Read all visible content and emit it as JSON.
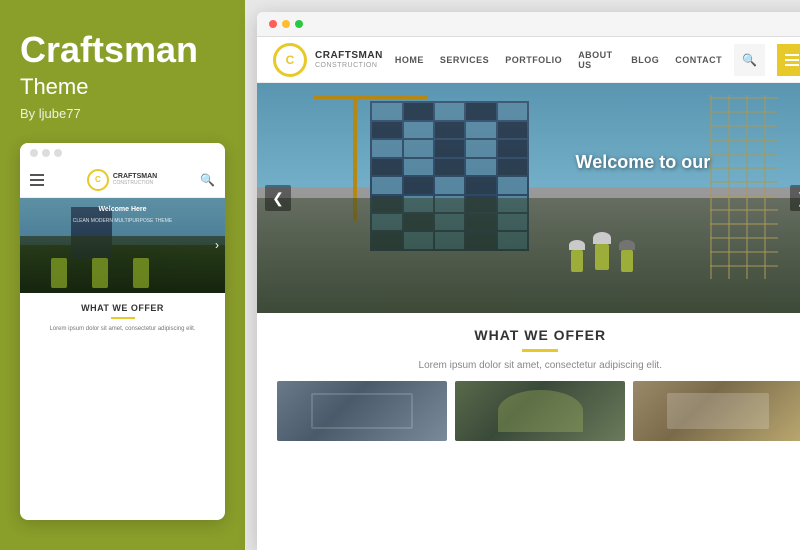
{
  "left": {
    "title": "Craftsman",
    "subtitle": "Theme",
    "author": "By ljube77"
  },
  "mobile": {
    "logo_letter": "C",
    "logo_name": "CRAFTSMAN",
    "logo_sub": "CONSTRUCTION",
    "hero_text": "Welcome Here",
    "hero_subtext": "CLEAN MODERN MULTIPURPOSE THEME",
    "offer_title": "WHAT WE OFFER",
    "offer_text": "Lorem ipsum dolor sit amet, consectetur adipiscing elit."
  },
  "desktop": {
    "logo_letter": "C",
    "logo_name": "CRAFTSMAN",
    "logo_sub": "CONSTRUCTION",
    "nav_items": [
      "HOME",
      "SERVICES",
      "PORTFOLIO",
      "ABOUT US",
      "BLOG",
      "CONTACT"
    ],
    "hero_welcome": "Welcome to our",
    "offer_title": "WHAT WE OFFER",
    "offer_text": "Lorem ipsum dolor sit amet, consectetur adipiscing elit.",
    "chevron_left": "❮",
    "chevron_right": "❯"
  },
  "colors": {
    "accent": "#e8c92a",
    "bg_left": "#8a9e2a",
    "text_white": "#ffffff",
    "nav_dark": "#333333"
  }
}
